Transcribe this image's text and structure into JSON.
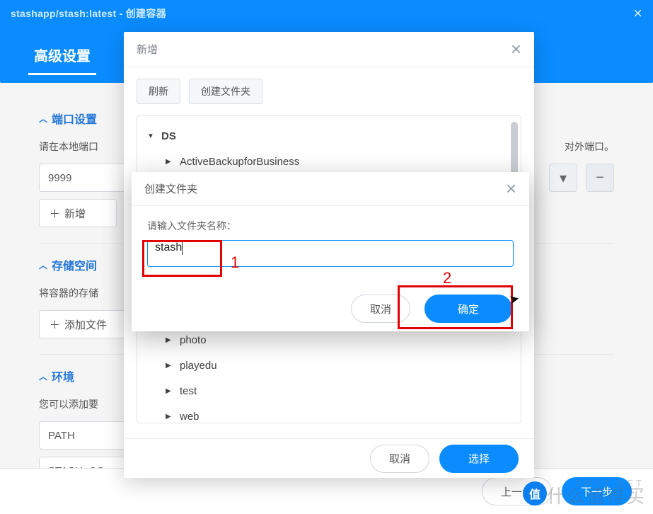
{
  "window": {
    "title": "stashapp/stash:latest - 创建容器",
    "tab_active": "高级设置"
  },
  "sections": {
    "port": {
      "title": "端口设置",
      "help_prefix": "请在本地端口",
      "help_suffix": "对外端口。",
      "value": "9999",
      "add_label": "新增"
    },
    "storage": {
      "title": "存储空间",
      "help": "将容器的存储",
      "add_label": "添加文件"
    },
    "env": {
      "title": "环境",
      "help": "您可以添加要",
      "rows": [
        "PATH",
        "STASH_CO"
      ]
    }
  },
  "footer": {
    "prev": "上一步",
    "next": "下一步"
  },
  "select_minus": "−",
  "select_chevron": "▾",
  "modal_browser": {
    "title": "新增",
    "refresh": "刷新",
    "create_folder": "创建文件夹",
    "root": "DS",
    "items": [
      "ActiveBackupforBusiness",
      "",
      "",
      "",
      "",
      "",
      "",
      "photo",
      "playedu",
      "test",
      "web"
    ],
    "cancel": "取消",
    "select": "选择"
  },
  "modal_create": {
    "title": "创建文件夹",
    "label": "请输入文件夹名称：",
    "value": "stash",
    "cancel": "取消",
    "ok": "确定"
  },
  "annotations": {
    "one": "1",
    "two": "2"
  },
  "watermark": {
    "badge": "值",
    "line1": "SMYZ.NET",
    "line2": "什么值得买"
  }
}
